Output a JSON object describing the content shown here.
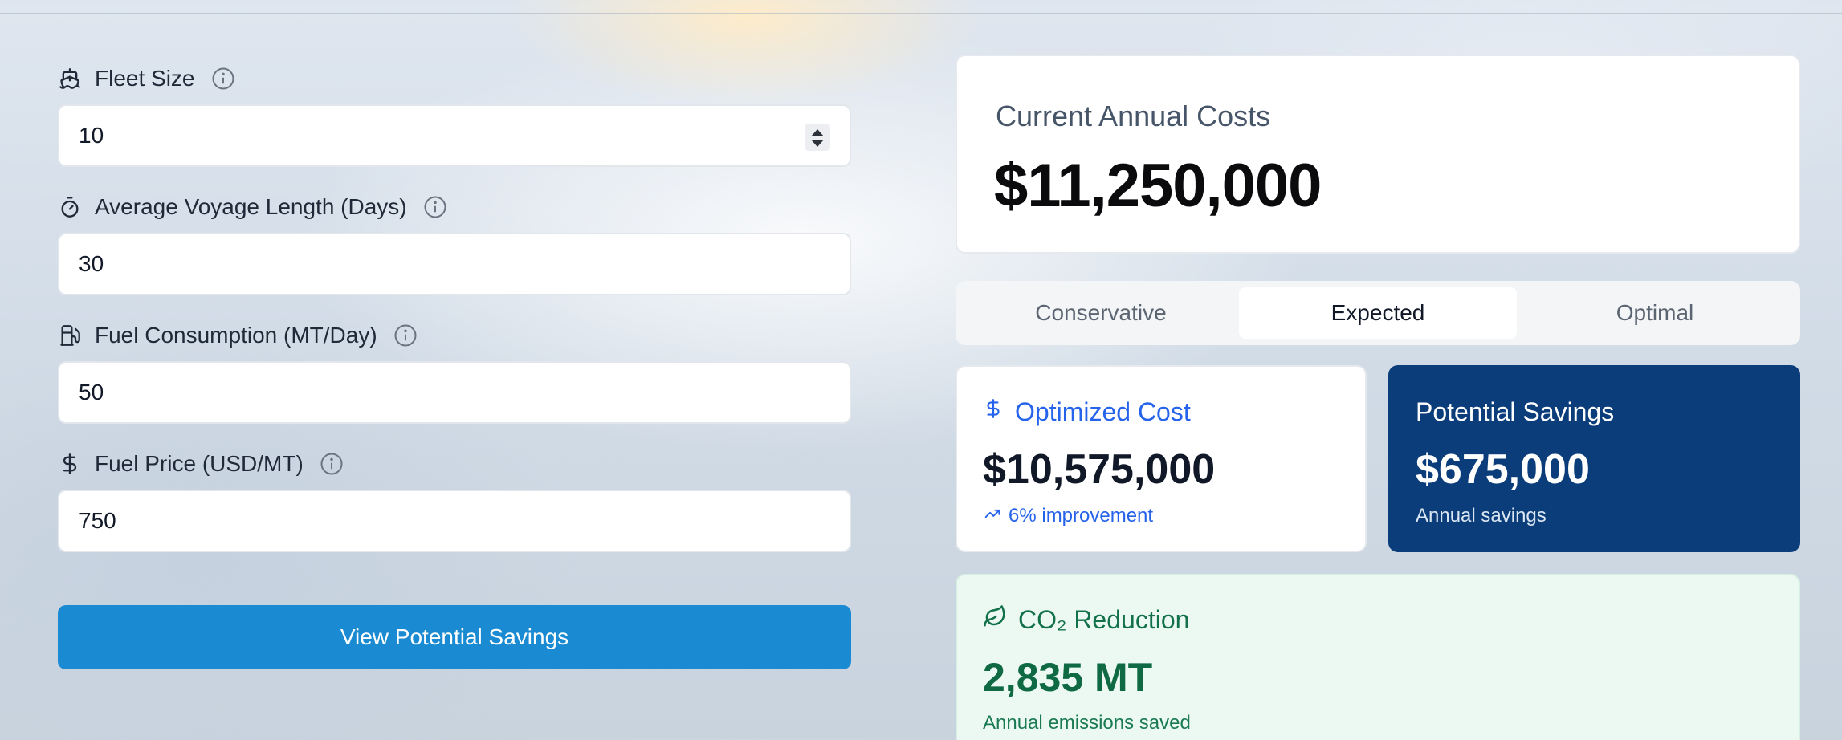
{
  "form": {
    "fleet_size": {
      "label": "Fleet Size",
      "value": "10"
    },
    "voyage_length": {
      "label": "Average Voyage Length (Days)",
      "value": "30"
    },
    "fuel_consumption": {
      "label": "Fuel Consumption (MT/Day)",
      "value": "50"
    },
    "fuel_price": {
      "label": "Fuel Price (USD/MT)",
      "value": "750"
    },
    "submit_label": "View Potential Savings"
  },
  "annual_costs": {
    "label": "Current Annual Costs",
    "value": "$11,250,000"
  },
  "scenario_tabs": {
    "items": [
      "Conservative",
      "Expected",
      "Optimal"
    ],
    "active": "Expected"
  },
  "optimized_cost": {
    "label": "Optimized Cost",
    "value": "$10,575,000",
    "improvement": "6% improvement"
  },
  "potential_savings": {
    "label": "Potential Savings",
    "value": "$675,000",
    "sub": "Annual savings"
  },
  "co2": {
    "label": "CO₂ Reduction",
    "value": "2,835 MT",
    "sub": "Annual emissions saved"
  },
  "colors": {
    "primary_button": "#1a8bd2",
    "accent_blue": "#2563eb",
    "savings_card": "#0a3d7a",
    "co2_green": "#13714a"
  },
  "icons": [
    "ship-icon",
    "stopwatch-icon",
    "fuel-pump-icon",
    "dollar-icon",
    "info-icon",
    "trend-up-icon",
    "leaf-icon"
  ]
}
